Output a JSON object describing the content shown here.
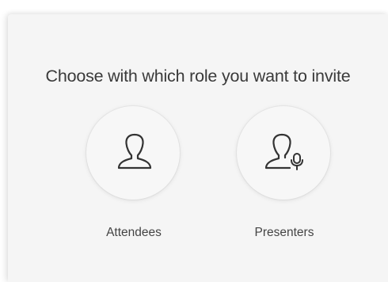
{
  "dialog": {
    "title": "Choose with which role you want to invite"
  },
  "roles": [
    {
      "label": "Attendees",
      "icon": "person-icon"
    },
    {
      "label": "Presenters",
      "icon": "person-microphone-icon"
    }
  ],
  "colors": {
    "dialog_background": "#f5f5f5",
    "circle_background": "#f7f7f7",
    "icon_stroke": "#333333",
    "title_text": "#3a3a3a",
    "label_text": "#444444"
  }
}
